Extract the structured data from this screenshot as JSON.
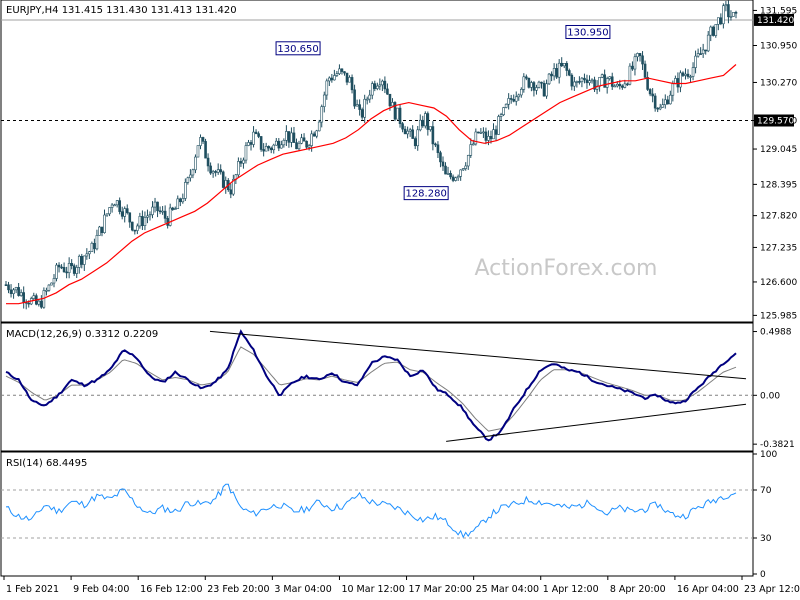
{
  "chart_data": [
    {
      "type": "candlestick",
      "title": "EURJPY,H4  131.415 131.430 131.413 131.420",
      "symbol": "EURJPY",
      "timeframe": "H4",
      "ohlc_last": {
        "open": 131.415,
        "high": 131.43,
        "low": 131.413,
        "close": 131.42
      },
      "watermark": "ActionForex.com",
      "ylim": [
        125.9,
        131.75
      ],
      "y_ticks": [
        "131.595",
        "130.950",
        "130.270",
        "129.570",
        "129.045",
        "128.395",
        "127.820",
        "127.235",
        "126.600",
        "125.985"
      ],
      "current_price_label": "131.420",
      "reference_line": {
        "value": 129.57,
        "label": "129.570",
        "style": "dashed"
      },
      "x_ticks": [
        "1 Feb 2021",
        "9 Feb 04:00",
        "16 Feb 12:00",
        "23 Feb 20:00",
        "3 Mar 04:00",
        "10 Mar 12:00",
        "17 Mar 20:00",
        "25 Mar 04:00",
        "1 Apr 12:00",
        "8 Apr 20:00",
        "16 Apr 04:00",
        "23 Apr 12:00"
      ],
      "annotations": [
        {
          "label": "130.650",
          "value": 130.65,
          "at": "10 Mar"
        },
        {
          "label": "128.280",
          "value": 128.28,
          "at": "23 Mar"
        },
        {
          "label": "130.950",
          "value": 130.95,
          "at": "14 Apr"
        }
      ],
      "price_path": [
        {
          "t": "1 Feb 2021",
          "v": 126.55
        },
        {
          "t": "2 Feb",
          "v": 126.45
        },
        {
          "t": "3 Feb",
          "v": 126.3
        },
        {
          "t": "4 Feb",
          "v": 126.15
        },
        {
          "t": "5 Feb",
          "v": 126.5
        },
        {
          "t": "6 Feb",
          "v": 126.9
        },
        {
          "t": "8 Feb",
          "v": 126.8
        },
        {
          "t": "9 Feb 04:00",
          "v": 127.05
        },
        {
          "t": "10 Feb",
          "v": 127.2
        },
        {
          "t": "11 Feb",
          "v": 127.65
        },
        {
          "t": "12 Feb",
          "v": 128.15
        },
        {
          "t": "13 Feb",
          "v": 127.9
        },
        {
          "t": "15 Feb",
          "v": 127.6
        },
        {
          "t": "16 Feb 12:00",
          "v": 127.8
        },
        {
          "t": "17 Feb",
          "v": 127.95
        },
        {
          "t": "18 Feb",
          "v": 127.75
        },
        {
          "t": "19 Feb",
          "v": 128.0
        },
        {
          "t": "20 Feb",
          "v": 128.45
        },
        {
          "t": "22 Feb",
          "v": 129.25
        },
        {
          "t": "23 Feb 20:00",
          "v": 128.75
        },
        {
          "t": "24 Feb",
          "v": 128.5
        },
        {
          "t": "25 Feb",
          "v": 128.3
        },
        {
          "t": "26 Feb",
          "v": 128.9
        },
        {
          "t": "1 Mar",
          "v": 129.3
        },
        {
          "t": "2 Mar",
          "v": 129.05
        },
        {
          "t": "3 Mar 04:00",
          "v": 129.1
        },
        {
          "t": "4 Mar",
          "v": 129.35
        },
        {
          "t": "5 Mar",
          "v": 129.1
        },
        {
          "t": "8 Mar",
          "v": 129.15
        },
        {
          "t": "9 Mar",
          "v": 129.5
        },
        {
          "t": "10 Mar 12:00",
          "v": 130.35
        },
        {
          "t": "11 Mar",
          "v": 130.45
        },
        {
          "t": "12 Mar",
          "v": 130.3
        },
        {
          "t": "13 Mar",
          "v": 129.6
        },
        {
          "t": "15 Mar",
          "v": 130.2
        },
        {
          "t": "16 Mar",
          "v": 130.4
        },
        {
          "t": "17 Mar 20:00",
          "v": 129.8
        },
        {
          "t": "18 Mar",
          "v": 129.5
        },
        {
          "t": "19 Mar",
          "v": 129.15
        },
        {
          "t": "20 Mar",
          "v": 129.65
        },
        {
          "t": "22 Mar",
          "v": 129.05
        },
        {
          "t": "23 Mar",
          "v": 128.5
        },
        {
          "t": "24 Mar",
          "v": 128.6
        },
        {
          "t": "25 Mar 04:00",
          "v": 128.9
        },
        {
          "t": "26 Mar",
          "v": 129.35
        },
        {
          "t": "29 Mar",
          "v": 129.2
        },
        {
          "t": "30 Mar",
          "v": 129.55
        },
        {
          "t": "31 Mar",
          "v": 129.95
        },
        {
          "t": "1 Apr 12:00",
          "v": 130.25
        },
        {
          "t": "2 Apr",
          "v": 130.3
        },
        {
          "t": "5 Apr",
          "v": 130.1
        },
        {
          "t": "6 Apr",
          "v": 130.45
        },
        {
          "t": "7 Apr",
          "v": 130.55
        },
        {
          "t": "8 Apr 20:00",
          "v": 130.2
        },
        {
          "t": "9 Apr",
          "v": 130.4
        },
        {
          "t": "12 Apr",
          "v": 130.2
        },
        {
          "t": "13 Apr",
          "v": 130.35
        },
        {
          "t": "14 Apr",
          "v": 130.15
        },
        {
          "t": "15 Apr",
          "v": 130.4
        },
        {
          "t": "16 Apr 04:00",
          "v": 130.75
        },
        {
          "t": "19 Apr",
          "v": 130.1
        },
        {
          "t": "20 Apr",
          "v": 129.75
        },
        {
          "t": "21 Apr",
          "v": 130.15
        },
        {
          "t": "22 Apr",
          "v": 130.4
        },
        {
          "t": "23 Apr 12:00",
          "v": 130.55
        },
        {
          "t": "24 Apr",
          "v": 130.9
        },
        {
          "t": "26 Apr",
          "v": 131.3
        },
        {
          "t": "27 Apr",
          "v": 131.6
        },
        {
          "t": "27 Apr close",
          "v": 131.42
        }
      ],
      "moving_average": {
        "color": "#ff0000",
        "path": [
          126.2,
          126.2,
          126.25,
          126.3,
          126.4,
          126.55,
          126.65,
          126.8,
          126.95,
          127.15,
          127.35,
          127.5,
          127.6,
          127.7,
          127.8,
          127.9,
          128.05,
          128.25,
          128.45,
          128.6,
          128.75,
          128.85,
          128.95,
          129.0,
          129.05,
          129.1,
          129.15,
          129.25,
          129.4,
          129.6,
          129.75,
          129.85,
          129.9,
          129.85,
          129.8,
          129.65,
          129.4,
          129.2,
          129.15,
          129.2,
          129.3,
          129.45,
          129.6,
          129.75,
          129.9,
          130.0,
          130.1,
          130.2,
          130.25,
          130.3,
          130.3,
          130.35,
          130.3,
          130.25,
          130.25,
          130.3,
          130.35,
          130.4,
          130.6
        ]
      },
      "price_color": "#1f4e5f"
    },
    {
      "type": "line",
      "title": "MACD(12,26,9) 0.3312 0.2209",
      "ylim": [
        -0.42,
        0.55
      ],
      "y_ticks": [
        "0.4988",
        "0.00",
        "-0.3821"
      ],
      "series": [
        {
          "color": "#000080",
          "values": [
            0.18,
            0.12,
            -0.05,
            -0.08,
            0.0,
            0.12,
            0.08,
            0.12,
            0.2,
            0.35,
            0.3,
            0.15,
            0.1,
            0.18,
            0.12,
            0.05,
            0.1,
            0.2,
            0.5,
            0.35,
            0.15,
            0.0,
            0.1,
            0.15,
            0.12,
            0.18,
            0.1,
            0.08,
            0.25,
            0.3,
            0.28,
            0.15,
            0.2,
            0.05,
            0.0,
            -0.1,
            -0.25,
            -0.35,
            -0.28,
            -0.1,
            0.05,
            0.2,
            0.25,
            0.2,
            0.18,
            0.12,
            0.08,
            0.05,
            0.02,
            -0.02,
            0.0,
            -0.06,
            -0.05,
            0.05,
            0.15,
            0.25,
            0.33
          ]
        },
        {
          "color": "#7f7f7f",
          "values": [
            0.15,
            0.1,
            0.02,
            -0.04,
            0.0,
            0.08,
            0.08,
            0.12,
            0.18,
            0.28,
            0.25,
            0.18,
            0.12,
            0.14,
            0.12,
            0.08,
            0.1,
            0.18,
            0.38,
            0.32,
            0.2,
            0.08,
            0.1,
            0.13,
            0.12,
            0.15,
            0.12,
            0.1,
            0.18,
            0.25,
            0.26,
            0.2,
            0.18,
            0.1,
            0.03,
            -0.06,
            -0.18,
            -0.28,
            -0.26,
            -0.15,
            -0.02,
            0.12,
            0.2,
            0.2,
            0.18,
            0.14,
            0.1,
            0.07,
            0.04,
            0.0,
            0.0,
            -0.04,
            -0.04,
            0.02,
            0.1,
            0.18,
            0.22
          ]
        }
      ],
      "trendlines": [
        {
          "from": "23 Feb",
          "to": "27 Apr",
          "v_from": 0.5,
          "v_to": 0.13
        },
        {
          "from": "23 Mar",
          "to": "27 Apr",
          "v_from": -0.36,
          "v_to": -0.07
        }
      ]
    },
    {
      "type": "line",
      "title": "RSI(14) 68.4495",
      "ylim": [
        0,
        100
      ],
      "y_ticks": [
        "100",
        "70",
        "30",
        "0"
      ],
      "levels": [
        70,
        30
      ],
      "series": [
        {
          "color": "#1e90ff",
          "values": [
            55,
            48,
            45,
            58,
            52,
            60,
            58,
            65,
            62,
            70,
            58,
            50,
            55,
            52,
            60,
            58,
            62,
            75,
            55,
            50,
            55,
            58,
            52,
            54,
            60,
            55,
            57,
            66,
            60,
            58,
            55,
            50,
            45,
            48,
            42,
            32,
            36,
            48,
            55,
            58,
            62,
            60,
            58,
            55,
            57,
            60,
            50,
            55,
            52,
            54,
            58,
            50,
            48,
            55,
            60,
            65,
            68
          ]
        }
      ]
    }
  ]
}
